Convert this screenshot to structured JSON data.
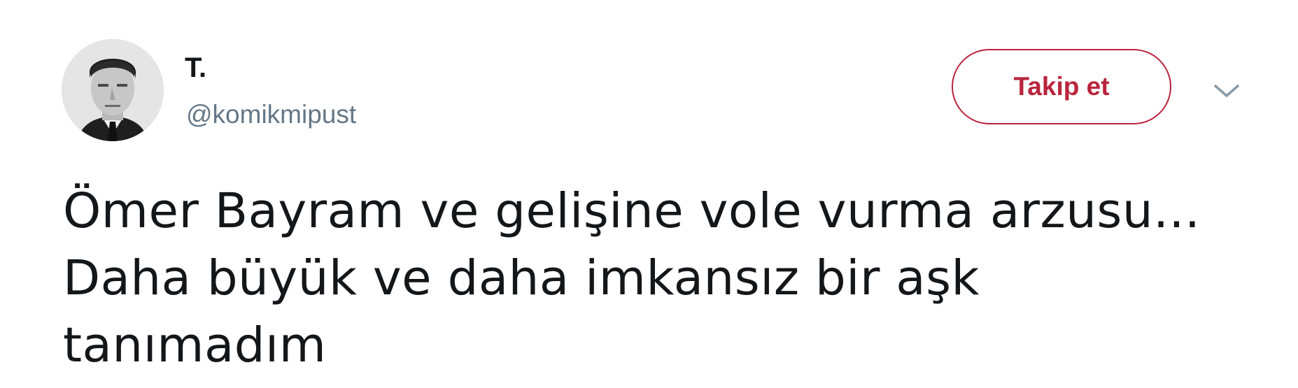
{
  "tweet": {
    "author": {
      "display_name": "T.",
      "handle": "@komikmipust"
    },
    "follow_label": "Takip et",
    "text_lines": [
      "Ömer Bayram ve gelişine vole vurma arzusu...",
      "Daha büyük ve daha imkansız bir aşk",
      "tanımadım"
    ]
  },
  "icons": {
    "avatar": "profile-photo",
    "caret": "chevron-down-icon"
  },
  "colors": {
    "accent": "#b9253d",
    "text_primary": "#14171a",
    "text_secondary": "#657786",
    "background": "#ffffff"
  }
}
